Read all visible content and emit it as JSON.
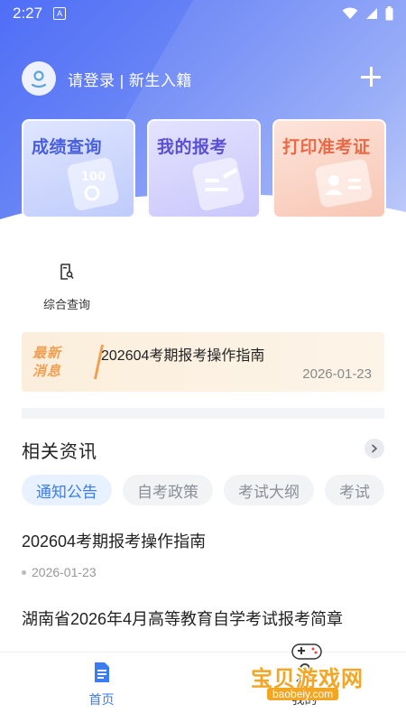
{
  "status_bar": {
    "time": "2:27",
    "badge": "A"
  },
  "header": {
    "login_text": "请登录 | 新生入籍"
  },
  "cards": [
    {
      "title": "成绩查询"
    },
    {
      "title": "我的报考"
    },
    {
      "title": "打印准考证"
    }
  ],
  "quick_actions": [
    {
      "label": "综合查询"
    }
  ],
  "latest_news": {
    "tag_line1": "最新",
    "tag_line2": "消息",
    "title": "202604考期报考操作指南",
    "date": "2026-01-23"
  },
  "info_section": {
    "title": "相关资讯",
    "tabs": [
      "通知公告",
      "自考政策",
      "考试大纲",
      "考试"
    ],
    "articles": [
      {
        "title": "202604考期报考操作指南",
        "date": "2026-01-23"
      },
      {
        "title": "湖南省2026年4月高等教育自学考试报考简章"
      }
    ]
  },
  "bottom_nav": [
    {
      "label": "首页"
    },
    {
      "label": "我的"
    }
  ],
  "watermark": {
    "text": "宝贝游戏网",
    "url": "baobeiy.com"
  },
  "colors": {
    "primary": "#3b7cf0",
    "hero_start": "#4f6ef7",
    "news_accent": "#f0a052",
    "print_card": "#e86a46"
  }
}
